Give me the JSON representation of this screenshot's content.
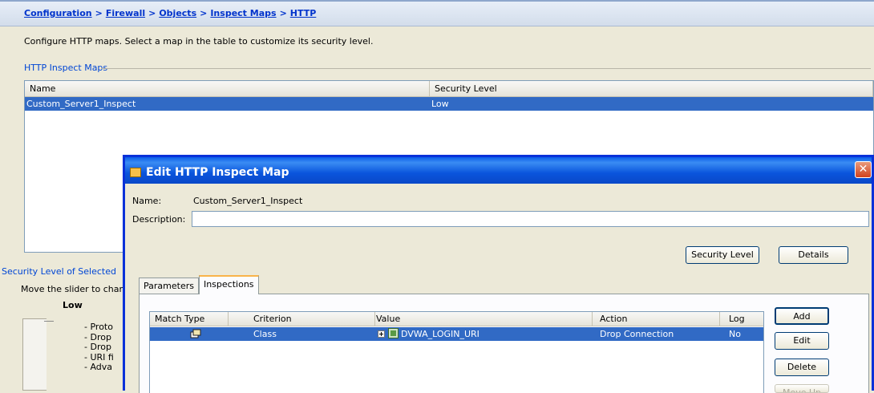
{
  "breadcrumb": {
    "items": [
      "Configuration",
      "Firewall",
      "Objects",
      "Inspect Maps",
      "HTTP"
    ],
    "separator": ">"
  },
  "intro_text": "Configure HTTP maps. Select a map in the table to customize its security level.",
  "maps_group": {
    "label": "HTTP Inspect Maps",
    "columns": [
      "Name",
      "Security Level"
    ],
    "rows": [
      {
        "name": "Custom_Server1_Inspect",
        "security_level": "Low"
      }
    ]
  },
  "security_panel": {
    "label": "Security Level of Selected",
    "move_text": "Move the slider to chan",
    "level": "Low",
    "bullets": [
      "Proto",
      "Drop",
      "Drop",
      "URI fi",
      "Adva"
    ]
  },
  "dialog": {
    "title": "Edit HTTP Inspect Map",
    "close": "✕",
    "name_label": "Name:",
    "name_value": "Custom_Server1_Inspect",
    "description_label": "Description:",
    "description_value": "",
    "security_level_button": "Security Level",
    "details_button": "Details",
    "tabs": [
      "Parameters",
      "Inspections"
    ],
    "active_tab": "Inspections",
    "inspections": {
      "columns": [
        "Match Type",
        "Criterion",
        "Value",
        "Action",
        "Log"
      ],
      "rows": [
        {
          "match_type_icon": "match-type-icon",
          "criterion": "Class",
          "value": "DVWA_LOGIN_URI",
          "action": "Drop Connection",
          "log": "No"
        }
      ]
    },
    "buttons": {
      "add": "Add",
      "edit": "Edit",
      "delete": "Delete",
      "move_up": "Move Up"
    }
  },
  "colors": {
    "selection": "#316ac5",
    "title_blue": "#0a5ee9",
    "link": "#0033cc",
    "group_label": "#0046d5"
  }
}
